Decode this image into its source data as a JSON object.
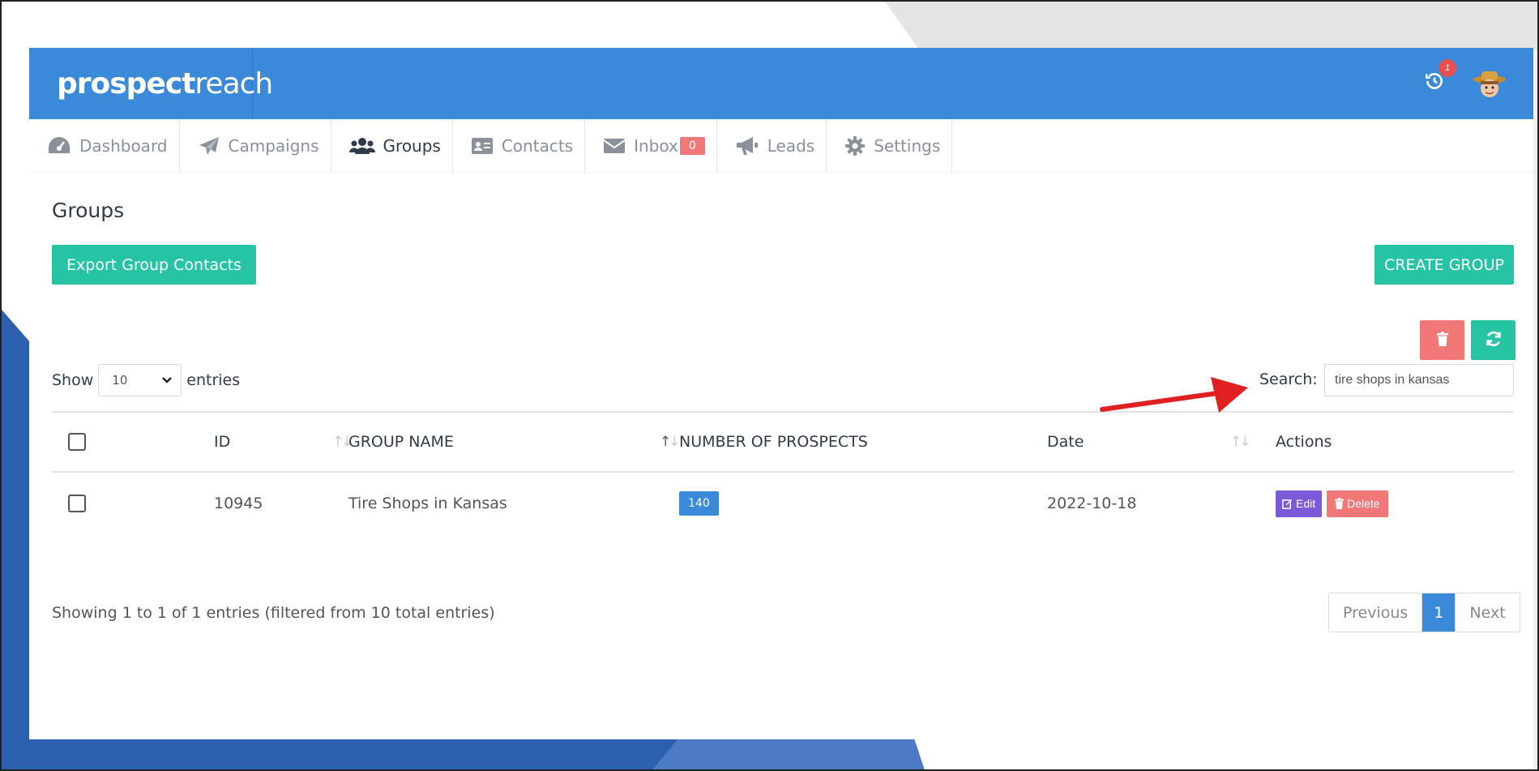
{
  "brand": {
    "name_bold": "prospect",
    "name_light": "reach"
  },
  "header": {
    "history_badge": "1"
  },
  "nav": {
    "items": [
      {
        "label": "Dashboard",
        "icon": "dashboard-icon"
      },
      {
        "label": "Campaigns",
        "icon": "paper-plane-icon"
      },
      {
        "label": "Groups",
        "icon": "users-icon",
        "active": true
      },
      {
        "label": "Contacts",
        "icon": "address-card-icon"
      },
      {
        "label": "Inbox",
        "icon": "envelope-icon",
        "badge": "0"
      },
      {
        "label": "Leads",
        "icon": "megaphone-icon"
      },
      {
        "label": "Settings",
        "icon": "gear-icon"
      }
    ]
  },
  "page": {
    "title": "Groups",
    "export_button": "Export Group Contacts",
    "create_button": "CREATE GROUP"
  },
  "table_controls": {
    "show_label": "Show",
    "entries_value": "10",
    "entries_label": "entries",
    "search_label": "Search:",
    "search_value": "tire shops in kansas"
  },
  "table": {
    "columns": [
      "ID",
      "GROUP NAME",
      "NUMBER OF PROSPECTS",
      "Date",
      "Actions"
    ],
    "rows": [
      {
        "id": "10945",
        "group_name": "Tire Shops in Kansas",
        "prospects": "140",
        "date": "2022-10-18",
        "edit": "Edit",
        "delete": "Delete"
      }
    ]
  },
  "footer": {
    "info": "Showing 1 to 1 of 1 entries (filtered from 10 total entries)",
    "previous": "Previous",
    "current_page": "1",
    "next": "Next"
  },
  "colors": {
    "header_blue": "#3a8ad9",
    "teal": "#26c4a4",
    "danger": "#f07878",
    "purple": "#7b5ad9",
    "annotation_red": "#e02020"
  }
}
